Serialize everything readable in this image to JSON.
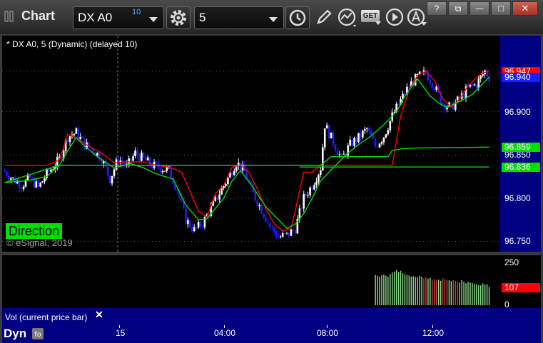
{
  "window": {
    "title": "Chart",
    "symbol": "DX A0",
    "delay_badge": "10",
    "interval": "5",
    "get_label": "GET",
    "win_help": "?",
    "win_restore": "⧉",
    "win_min": "—",
    "win_max": "□",
    "win_close": "✕"
  },
  "chart": {
    "study_label": "* DX A0, 5 (Dynamic) (delayed 10)",
    "direction_label": "Direction",
    "copyright": "© eSignal, 2019",
    "vol_label": "Vol (current price bar)",
    "vol_close": "✕",
    "dyn_label": "Dyn",
    "colors": {
      "up": "#ffffff",
      "down": "#1c1cff",
      "red_line": "#ff0000",
      "green_line": "#00dd00",
      "scale_bg": "#000080"
    }
  },
  "chart_data": {
    "type": "candlestick",
    "title": "",
    "price_axis": {
      "ticks": [
        "96.900",
        "96.850",
        "96.800",
        "96.750"
      ],
      "ylim": [
        96.738,
        96.988
      ]
    },
    "price_tags": [
      {
        "value": "96.947",
        "color": "#ff0000"
      },
      {
        "value": "96.940",
        "color": "#1c1cff"
      },
      {
        "value": "96.859",
        "color": "#00dd00"
      },
      {
        "value": "96.836",
        "color": "#00dd00"
      }
    ],
    "volume_axis": {
      "ticks": [
        "250",
        "0"
      ],
      "current": "107",
      "current_color": "#ff0000",
      "ylim": [
        0,
        280
      ]
    },
    "time_axis": {
      "labels": [
        "15",
        "04:00",
        "08:00",
        "12:00"
      ]
    },
    "close_anchors": [
      [
        0,
        96.831
      ],
      [
        4,
        96.822
      ],
      [
        8,
        96.815
      ],
      [
        12,
        96.823
      ],
      [
        16,
        96.812
      ],
      [
        20,
        96.828
      ],
      [
        26,
        96.845
      ],
      [
        30,
        96.871
      ],
      [
        34,
        96.876
      ],
      [
        38,
        96.862
      ],
      [
        42,
        96.856
      ],
      [
        46,
        96.846
      ],
      [
        50,
        96.822
      ],
      [
        54,
        96.846
      ],
      [
        58,
        96.836
      ],
      [
        62,
        96.852
      ],
      [
        66,
        96.845
      ],
      [
        70,
        96.838
      ],
      [
        74,
        96.835
      ],
      [
        78,
        96.832
      ],
      [
        82,
        96.81
      ],
      [
        86,
        96.775
      ],
      [
        90,
        96.763
      ],
      [
        94,
        96.771
      ],
      [
        98,
        96.788
      ],
      [
        102,
        96.806
      ],
      [
        106,
        96.823
      ],
      [
        110,
        96.842
      ],
      [
        114,
        96.83
      ],
      [
        118,
        96.805
      ],
      [
        122,
        96.787
      ],
      [
        126,
        96.767
      ],
      [
        130,
        96.755
      ],
      [
        134,
        96.757
      ],
      [
        138,
        96.765
      ],
      [
        142,
        96.8
      ],
      [
        146,
        96.815
      ],
      [
        150,
        96.835
      ],
      [
        152,
        96.885
      ],
      [
        156,
        96.865
      ],
      [
        160,
        96.845
      ],
      [
        164,
        96.862
      ],
      [
        168,
        96.87
      ],
      [
        172,
        96.88
      ],
      [
        176,
        96.86
      ],
      [
        180,
        96.872
      ],
      [
        184,
        96.895
      ],
      [
        188,
        96.913
      ],
      [
        192,
        96.93
      ],
      [
        196,
        96.94
      ],
      [
        200,
        96.945
      ],
      [
        204,
        96.93
      ],
      [
        208,
        96.91
      ],
      [
        212,
        96.905
      ],
      [
        216,
        96.915
      ],
      [
        220,
        96.927
      ],
      [
        224,
        96.932
      ],
      [
        228,
        96.947
      ],
      [
        230,
        96.94
      ]
    ],
    "red_line": [
      [
        0,
        96.838
      ],
      [
        20,
        96.838
      ],
      [
        26,
        96.844
      ],
      [
        30,
        96.874
      ],
      [
        34,
        96.87
      ],
      [
        40,
        96.86
      ],
      [
        46,
        96.852
      ],
      [
        52,
        96.841
      ],
      [
        58,
        96.842
      ],
      [
        66,
        96.842
      ],
      [
        72,
        96.838
      ],
      [
        78,
        96.836
      ],
      [
        84,
        96.83
      ],
      [
        88,
        96.808
      ],
      [
        92,
        96.785
      ],
      [
        96,
        96.778
      ],
      [
        100,
        96.805
      ],
      [
        104,
        96.815
      ],
      [
        108,
        96.836
      ],
      [
        112,
        96.838
      ],
      [
        116,
        96.83
      ],
      [
        120,
        96.81
      ],
      [
        124,
        96.788
      ],
      [
        128,
        96.77
      ],
      [
        132,
        96.762
      ],
      [
        136,
        96.765
      ],
      [
        138,
        96.786
      ],
      [
        142,
        96.83
      ],
      [
        146,
        96.83
      ],
      [
        150,
        96.838
      ],
      [
        160,
        96.838
      ],
      [
        170,
        96.838
      ],
      [
        178,
        96.838
      ],
      [
        184,
        96.838
      ],
      [
        188,
        96.895
      ],
      [
        192,
        96.925
      ],
      [
        196,
        96.942
      ],
      [
        200,
        96.947
      ],
      [
        204,
        96.936
      ],
      [
        208,
        96.915
      ],
      [
        212,
        96.905
      ],
      [
        216,
        96.915
      ],
      [
        220,
        96.93
      ],
      [
        226,
        96.944
      ],
      [
        230,
        96.947
      ]
    ],
    "green_line": [
      [
        0,
        96.818
      ],
      [
        10,
        96.82
      ],
      [
        20,
        96.825
      ],
      [
        26,
        96.838
      ],
      [
        30,
        96.855
      ],
      [
        34,
        96.87
      ],
      [
        38,
        96.86
      ],
      [
        44,
        96.848
      ],
      [
        52,
        96.835
      ],
      [
        60,
        96.84
      ],
      [
        66,
        96.835
      ],
      [
        72,
        96.828
      ],
      [
        80,
        96.822
      ],
      [
        86,
        96.792
      ],
      [
        92,
        96.775
      ],
      [
        96,
        96.776
      ],
      [
        100,
        96.788
      ],
      [
        104,
        96.8
      ],
      [
        108,
        96.82
      ],
      [
        112,
        96.832
      ],
      [
        118,
        96.812
      ],
      [
        124,
        96.79
      ],
      [
        130,
        96.775
      ],
      [
        134,
        96.765
      ],
      [
        138,
        96.77
      ],
      [
        142,
        96.782
      ],
      [
        146,
        96.8
      ],
      [
        150,
        96.82
      ],
      [
        156,
        96.835
      ],
      [
        162,
        96.85
      ],
      [
        168,
        96.862
      ],
      [
        174,
        96.872
      ],
      [
        180,
        96.885
      ],
      [
        186,
        96.9
      ],
      [
        190,
        96.918
      ],
      [
        196,
        96.938
      ],
      [
        202,
        96.918
      ],
      [
        206,
        96.91
      ],
      [
        210,
        96.905
      ],
      [
        216,
        96.912
      ],
      [
        222,
        96.92
      ],
      [
        228,
        96.935
      ],
      [
        230,
        96.94
      ]
    ],
    "green_flat": [
      [
        0,
        96.818
      ],
      [
        26,
        96.838
      ],
      [
        50,
        96.838
      ],
      [
        80,
        96.838
      ],
      [
        140,
        96.838
      ],
      [
        150,
        96.838
      ],
      [
        155,
        96.848
      ],
      [
        182,
        96.848
      ],
      [
        184,
        96.855
      ],
      [
        188,
        96.857
      ],
      [
        195,
        96.858
      ],
      [
        230,
        96.859
      ]
    ],
    "green_flat2": [
      [
        140,
        96.836
      ],
      [
        230,
        96.836
      ]
    ],
    "bar_count": 231,
    "price_axis_label": "",
    "volume_start_index": 176,
    "volume_values": [
      180,
      175,
      170,
      178,
      182,
      176,
      168,
      185,
      195,
      200,
      210,
      198,
      205,
      190,
      185,
      180,
      176,
      170,
      172,
      168,
      165,
      175,
      170,
      160,
      165,
      158,
      162,
      150,
      155,
      148,
      152,
      145,
      160,
      155,
      150,
      148,
      142,
      150,
      145,
      140,
      135,
      150,
      140,
      130,
      138,
      135,
      132,
      128,
      125,
      120,
      118,
      130,
      122,
      125,
      110
    ]
  }
}
